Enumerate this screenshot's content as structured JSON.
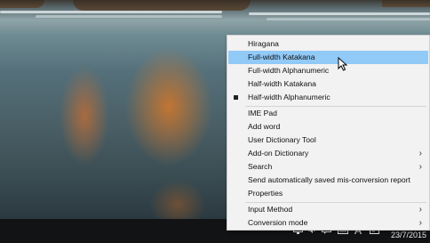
{
  "ime_menu": {
    "items": [
      {
        "label": "Hiragana",
        "highlighted": false,
        "selected": false,
        "submenu": false
      },
      {
        "label": "Full-width Katakana",
        "highlighted": true,
        "selected": false,
        "submenu": false
      },
      {
        "label": "Full-width Alphanumeric",
        "highlighted": false,
        "selected": false,
        "submenu": false
      },
      {
        "label": "Half-width Katakana",
        "highlighted": false,
        "selected": false,
        "submenu": false
      },
      {
        "label": "Half-width Alphanumeric",
        "highlighted": false,
        "selected": true,
        "submenu": false
      },
      {
        "label": "IME Pad",
        "submenu": false
      },
      {
        "label": "Add word",
        "submenu": false
      },
      {
        "label": "User Dictionary Tool",
        "submenu": false
      },
      {
        "label": "Add-on Dictionary",
        "submenu": true
      },
      {
        "label": "Search",
        "submenu": true
      },
      {
        "label": "Send automatically saved mis-conversion report",
        "submenu": false
      },
      {
        "label": "Properties",
        "submenu": false
      },
      {
        "label": "Input Method",
        "submenu": true
      },
      {
        "label": "Conversion mode",
        "submenu": true
      }
    ],
    "highlight_color": "#91c9f7"
  },
  "taskbar": {
    "ime_indicator": "A",
    "date": "23/7/2015",
    "tray_icons": [
      "chevron-up-icon",
      "network-icon",
      "volume-icon",
      "notification-icon",
      "keyboard-icon",
      "ime-mode-icon"
    ]
  }
}
